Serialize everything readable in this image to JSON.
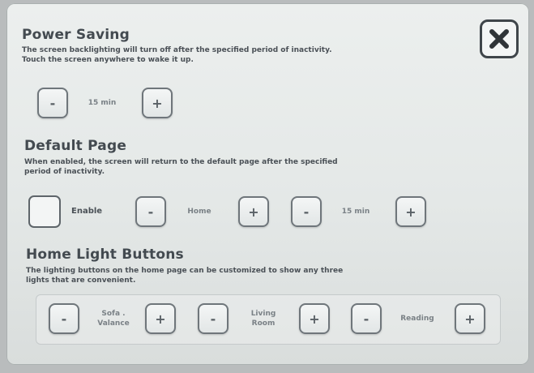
{
  "close_button": {
    "icon": "close-icon"
  },
  "power_saving": {
    "title": "Power Saving",
    "description_line1": "The screen backlighting will turn off after the specified period of inactivity.",
    "description_line2": "Touch the screen anywhere to wake it up.",
    "timeout_value": "15 min",
    "decrement_label": "-",
    "increment_label": "+"
  },
  "default_page": {
    "title": "Default Page",
    "description_line1": "When enabled, the screen will return to the default page after the specified",
    "description_line2": "period of inactivity.",
    "enable_label": "Enable",
    "page_value": "Home",
    "timeout_value": "15 min",
    "decrement_label": "-",
    "increment_label": "+"
  },
  "home_light_buttons": {
    "title": "Home Light Buttons",
    "description_line1": "The lighting buttons on the home page can be customized to show any three",
    "description_line2": "lights that are convenient.",
    "slots": [
      {
        "line1": "Sofa .",
        "line2": "Valance"
      },
      {
        "line1": "Living",
        "line2": "Room"
      },
      {
        "line1": "Reading",
        "line2": ""
      }
    ],
    "decrement_label": "-",
    "increment_label": "+"
  }
}
